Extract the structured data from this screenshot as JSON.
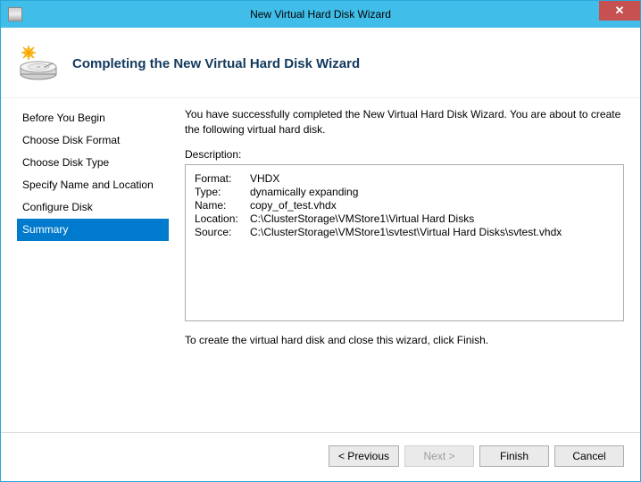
{
  "window": {
    "title": "New Virtual Hard Disk Wizard",
    "close_glyph": "✕"
  },
  "header": {
    "page_title": "Completing the New Virtual Hard Disk Wizard"
  },
  "sidebar": {
    "items": [
      {
        "label": "Before You Begin",
        "active": false
      },
      {
        "label": "Choose Disk Format",
        "active": false
      },
      {
        "label": "Choose Disk Type",
        "active": false
      },
      {
        "label": "Specify Name and Location",
        "active": false
      },
      {
        "label": "Configure Disk",
        "active": false
      },
      {
        "label": "Summary",
        "active": true
      }
    ]
  },
  "main": {
    "intro": "You have successfully completed the New Virtual Hard Disk Wizard. You are about to create the following virtual hard disk.",
    "description_label": "Description:",
    "description": {
      "rows": [
        {
          "key": "Format:",
          "value": "VHDX"
        },
        {
          "key": "Type:",
          "value": "dynamically expanding"
        },
        {
          "key": "Name:",
          "value": "copy_of_test.vhdx"
        },
        {
          "key": "Location:",
          "value": "C:\\ClusterStorage\\VMStore1\\Virtual Hard Disks"
        },
        {
          "key": "Source:",
          "value": "C:\\ClusterStorage\\VMStore1\\svtest\\Virtual Hard Disks\\svtest.vhdx"
        }
      ]
    },
    "finish_text": "To create the virtual hard disk and close this wizard, click Finish."
  },
  "footer": {
    "previous": "< Previous",
    "next": "Next >",
    "finish": "Finish",
    "cancel": "Cancel"
  }
}
